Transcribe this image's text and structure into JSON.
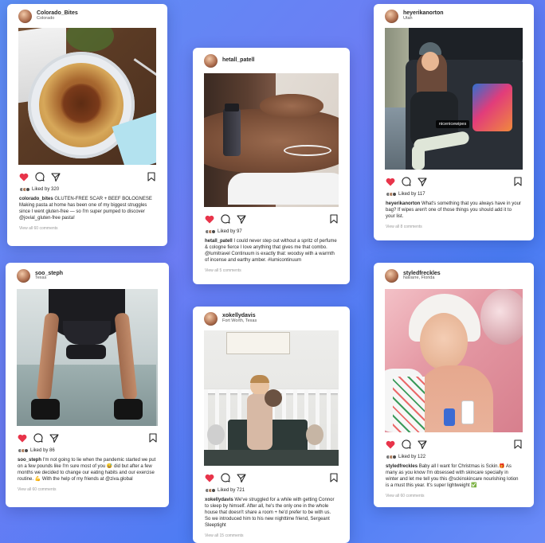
{
  "posts": [
    {
      "username": "Colorado_Bites",
      "location": "Colorado",
      "likes": "Liked by 320",
      "caption_user": "colorado_bites",
      "caption_text": "GLUTEN-FREE SCAR + BEEF BOLOGNESE Making pasta at home has been one of my biggest struggles since I went gluten-free — so I'm super pumped to discover @jovial_gluten-free pasta!",
      "view_all": "View all 60 comments"
    },
    {
      "username": "hetall_patell",
      "location": "",
      "likes": "Liked by 97",
      "caption_user": "hetall_patell",
      "caption_text": "I could never step out without a spritz of perfume & cologne fierce I love anything that gives me that combo. @lumitravel Continuum is exactly that: woodsy with a warmth of incense and earthy amber. #lumicontinuum",
      "view_all": "View all 5 comments"
    },
    {
      "username": "heyerikanorton",
      "location": "Utah",
      "tag": "nicenicewipes",
      "likes": "Liked by 117",
      "caption_user": "heyerikanorton",
      "caption_text": "What's something that you always have in your bag? If wipes aren't one of those things you should add it to your list.",
      "view_all": "View all 8 comments"
    },
    {
      "username": "soo_steph",
      "location": "Texas",
      "likes": "Liked by 86",
      "caption_user": "soo_steph",
      "caption_text": "I'm not going to lie when the pandemic started we put on a few pounds like I'm sure most of you 😅 did but after a few months we decided to change our eating habits and our exercise routine. 💪 With the help of my friends at @ziva.global",
      "view_all": "View all 60 comments"
    },
    {
      "username": "xokellydavis",
      "location": "Fort Worth, Texas",
      "likes": "Liked by 721",
      "caption_user": "xokellydavis",
      "caption_text": "We've struggled for a while with getting Connor to sleep by himself. After all, he's the only one in the whole house that doesn't share a room + he'd prefer to be with us. So we introduced him to his new nighttime friend, Sergeant Sleeptight",
      "view_all": "View all 15 comments"
    },
    {
      "username": "styledfreckles",
      "location": "Navarre, Florida",
      "likes": "Liked by 122",
      "caption_user": "styledfreckles",
      "caption_text": "Baby all I want for Christmas is Sckin.🎁 As many as you know I'm obsessed with skincare specially in winter and let me tell you this @sckinskincare nourishing lotion is a must this year. It's super lightweight ✅",
      "view_all": "View all 60 comments"
    }
  ],
  "colors": {
    "heart": "#e8344a",
    "text": "#262626",
    "muted": "#999999"
  },
  "icons": [
    "heart-icon",
    "comment-icon",
    "share-icon",
    "bookmark-icon"
  ]
}
